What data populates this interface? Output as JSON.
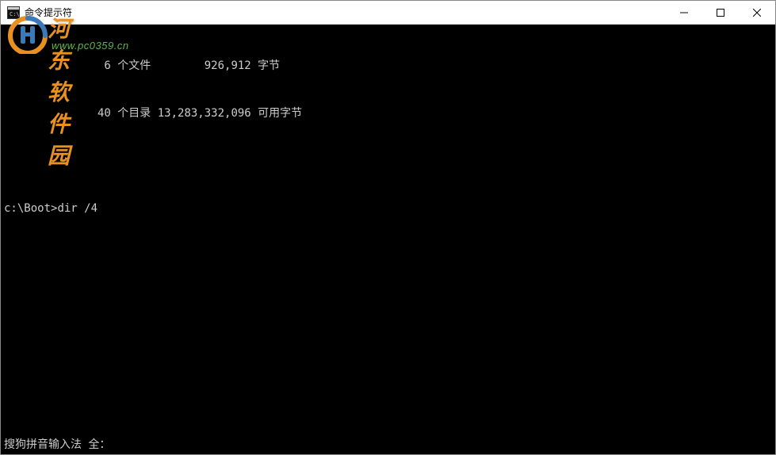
{
  "titlebar": {
    "title": "命令提示符"
  },
  "terminal": {
    "line1_files_count": "               6 ",
    "line1_files_label": "个文件",
    "line1_bytes": "        926,912 ",
    "line1_bytes_label": "字节",
    "line2_dirs_count": "              40 ",
    "line2_dirs_label": "个目录",
    "line2_free_bytes": " 13,283,332,096 ",
    "line2_free_label": "可用字节",
    "prompt": "c:\\Boot>",
    "command": "dir /4",
    "ime_status": "搜狗拼音输入法 全："
  },
  "watermark": {
    "text": "河东软件园",
    "url": "www.pc0359.cn"
  }
}
